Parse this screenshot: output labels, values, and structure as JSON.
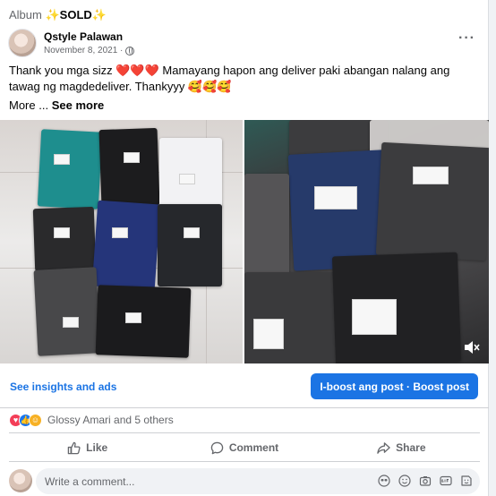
{
  "post": {
    "album_prefix": "Album",
    "album_name": "✨SOLD✨",
    "author": "Qstyle Palawan",
    "date": "November 8, 2021 ·",
    "text": "Thank you mga sizz ❤️❤️❤️ Mamayang hapon ang deliver paki abangan nalang ang tawag ng magdedeliver. Thankyyy 🥰🥰🥰",
    "more_prefix": "More ...",
    "see_more": "See more"
  },
  "actions": {
    "insights": "See insights and ads",
    "boost": "I-boost ang post · Boost post"
  },
  "reactions": {
    "summary": "Glossy Amari and 5 others",
    "types": [
      "love-icon",
      "like-icon",
      "care-icon"
    ]
  },
  "buttons": {
    "like": "Like",
    "comment": "Comment",
    "share": "Share"
  },
  "composer": {
    "placeholder": "Write a comment..."
  },
  "colors": {
    "accent": "#1b74e4",
    "secondary_text": "#65676b"
  }
}
